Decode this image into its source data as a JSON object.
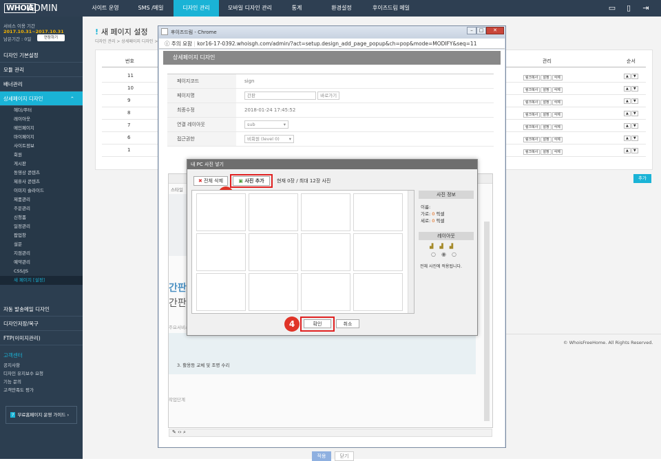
{
  "header": {
    "logo": "WHOIS",
    "app": "ADMIN",
    "nav": [
      "사이트 운영",
      "SMS /메일",
      "디자인 관리",
      "모바일 디자인 관리",
      "통계",
      "환경설정",
      "후이즈드림 메일"
    ]
  },
  "sidebar": {
    "service_label": "서비스 이용 기간",
    "service_period": "2017.10.31~2017.10.31",
    "remain_label": "남은기간 : 0일",
    "extend_button": "연장하기",
    "menu": [
      "디자인 기본설정",
      "모듈 관리",
      "배너관리",
      "상세페이지 디자인"
    ],
    "submenu": [
      "헤더/푸터",
      "레이아웃",
      "메인페이지",
      "마이페이지",
      "사이트정보",
      "회원",
      "게시판",
      "동영상 콘텐츠",
      "제휴사 콘텐츠",
      "이미지 슬라이드",
      "제품관리",
      "주문관리",
      "신청폼",
      "일정관리",
      "팝업창",
      "설문",
      "지점관리",
      "예약관리",
      "CSS/JS",
      "새 페이지 [설정]"
    ],
    "menu2": [
      "자동 발송메일 디자인",
      "디자인저장/복구",
      "FTP(이미지관리)"
    ],
    "support_title": "고객센터",
    "support_items": [
      "공지사항",
      "디자인 유지보수 요청",
      "기능 문의",
      "고객만족도 평가"
    ],
    "guide_button": "무료홈페이지 운영 가이드"
  },
  "main": {
    "title": "새 페이지 설정",
    "breadcrumb": "디자인 관리 > 상세페이지 디자인 > 새 페이지 설정",
    "columns": {
      "num": "번호",
      "manage": "관리",
      "order": "순서"
    },
    "rows": [
      "11",
      "10",
      "9",
      "8",
      "7",
      "6",
      "1"
    ],
    "row_buttons": [
      "링크복사",
      "설정",
      "삭제"
    ],
    "add_button": "추가",
    "footer": "© WhoisFreeHome. All Rights Reserved."
  },
  "chrome": {
    "title": "후이즈드림 - Chrome",
    "url_warning": "주의 요함",
    "url": "kor16-17-0392.whoisgh.com/admin/?act=setup.design_add_page_popup&ch=pop&mode=MODIFY&seq=11"
  },
  "popup": {
    "heading": "상세페이지 디자인",
    "fields": [
      {
        "label": "페이지코드",
        "value": "sign"
      },
      {
        "label": "페이지명",
        "value": "간판",
        "button": "바로가기"
      },
      {
        "label": "최종수정",
        "value": "2018-01-24 17:45:52"
      },
      {
        "label": "연결 레이아웃",
        "value": "sub"
      },
      {
        "label": "접근권한",
        "value": "비회원 (level 0)"
      }
    ],
    "editor": {
      "style_label": "스타일",
      "heading_text": "간판",
      "heading_text2": "간판",
      "sub_label": "주요서비스",
      "list3": "3. 활용등 교체 및 조명 수리",
      "step_label": "작업단계"
    },
    "apply_button": "적용",
    "close_button": "닫기"
  },
  "dialog": {
    "title": "내 PC 사진 넣기",
    "delete_all": "전체 삭제",
    "add_photo": "사진 추가",
    "count_text": "현재 0장 / 최대 12장 사진",
    "info_head": "사진 정보",
    "info_name": "이름:",
    "info_width_label": "가로:",
    "info_width": "0",
    "info_width_unit": "픽셀",
    "info_height_label": "세로:",
    "info_height": "0",
    "info_height_unit": "픽셀",
    "layout_head": "레이아웃",
    "layout_note": "전체 사진에 적용됩니다.",
    "ok": "확인",
    "cancel": "취소",
    "badge3": "3",
    "badge4": "4"
  },
  "colors": {
    "accent": "#1ab3d6",
    "topbar": "#2e3f52",
    "sidebar": "#2c3e50",
    "highlight": "#e02020",
    "warn": "#e05a00"
  }
}
